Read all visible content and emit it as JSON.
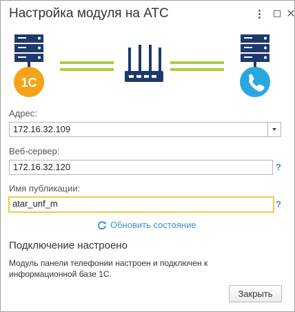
{
  "window": {
    "title": "Настройка модуля на АТС"
  },
  "icons": {
    "more": "more-vertical-icon",
    "maximize": "maximize-icon",
    "close": "close-icon",
    "server": "server-icon",
    "onec": "1c-logo-icon",
    "router": "router-icon",
    "phone": "phone-icon",
    "refresh": "refresh-icon"
  },
  "colors": {
    "link_green": "#a9cf3b",
    "onec_orange": "#f4a31a",
    "phone_blue": "#29a8e0",
    "server_navy": "#1e3a6b",
    "active_border": "#f2c83f",
    "link_blue": "#3a8fd9"
  },
  "form": {
    "address": {
      "label": "Адрес:",
      "value": "172.16.32.109"
    },
    "web_server": {
      "label": "Веб-сервер:",
      "value": "172.16.32.120",
      "help": "?"
    },
    "publication": {
      "label": "Имя публикации:",
      "value": "atar_unf_m",
      "help": "?"
    }
  },
  "refresh": {
    "label": "Обновить состояние"
  },
  "status": {
    "title": "Подключение настроено",
    "text": "Модуль панели телефонии настроен и подключен к информационной базе 1С."
  },
  "footer": {
    "close_label": "Закрыть"
  }
}
